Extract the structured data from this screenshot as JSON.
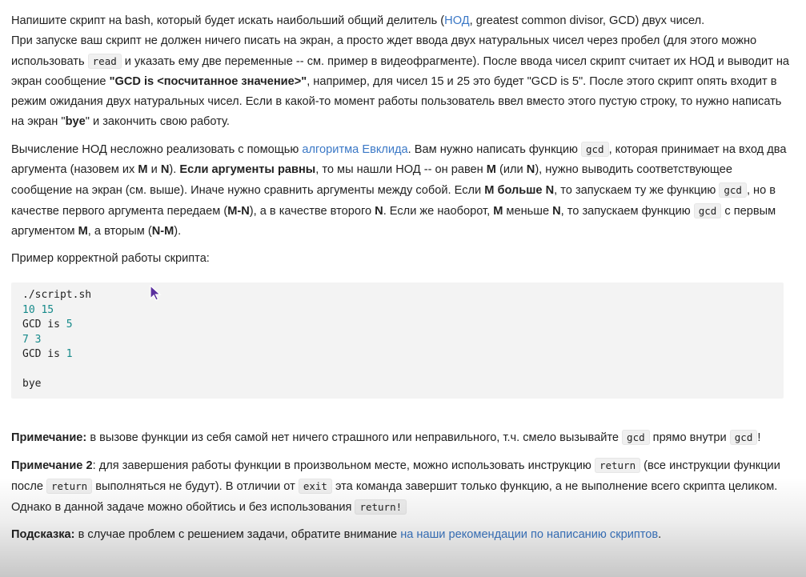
{
  "p1": {
    "t1": "Напишите скрипт на bash, который будет искать наибольший общий делитель (",
    "link_nod": "НОД",
    "t2": ", greatest common divisor, GCD) двух чисел.",
    "t3": "При запуске ваш скрипт не должен ничего писать на экран, а просто ждет ввода двух натуральных чисел через пробел (для этого можно использовать ",
    "code_read": "read",
    "t4": " и указать ему две переменные -- см. пример в видеофрагменте). После ввода чисел скрипт считает их НОД и выводит на экран сообщение ",
    "bold_msg": "\"GCD is <посчитанное значение>\"",
    "t5": ", например, для чисел 15 и 25 это будет \"GCD is 5\". После этого скрипт опять входит в режим ожидания двух натуральных чисел. Если в какой-то момент работы пользователь ввел вместо этого пустую строку, то нужно написать на экран \"",
    "bold_bye": "bye",
    "t6": "\" и закончить свою работу."
  },
  "p2": {
    "t1": "Вычисление НОД несложно реализовать с помощью ",
    "link_euclid": "алгоритма Евклида",
    "t2": ". Вам нужно написать функцию ",
    "code_gcd1": "gcd",
    "t3": ", которая принимает на вход два аргумента (назовем их ",
    "b_m1": "M",
    "t4": " и ",
    "b_n1": "N",
    "t5": "). ",
    "b_equal": "Если аргументы равны",
    "t6": ", то мы нашли НОД -- он равен ",
    "b_m2": "M",
    "t7": " (или ",
    "b_n2": "N",
    "t8": "), нужно выводить соответствующее сообщение на экран (см. выше). Иначе нужно сравнить аргументы между собой. Если ",
    "b_m_gt_n": "M больше N",
    "t9": ", то запускаем ту же функцию ",
    "code_gcd2": "gcd",
    "t10": ", но в качестве первого аргумента передаем (",
    "b_mn": "M-N",
    "t11": "), а в качестве второго ",
    "b_n3": "N",
    "t12": ". Если же наоборот, ",
    "b_m3": "M",
    "t13": " меньше ",
    "b_n4": "N",
    "t14": ", то запускаем функцию ",
    "code_gcd3": "gcd",
    "t15": " с первым аргументом ",
    "b_m4": "M",
    "t16": ", а вторым (",
    "b_nm": "N-M",
    "t17": ")."
  },
  "p3": {
    "text": "Пример корректной работы скрипта:"
  },
  "code": {
    "l1": "./script.sh",
    "l2_a": "10",
    "l2_b": "15",
    "l3_a": "GCD is ",
    "l3_b": "5",
    "l4_a": "7",
    "l4_b": "3",
    "l5_a": "GCD is ",
    "l5_b": "1",
    "l7": "bye"
  },
  "note1": {
    "label": "Примечание:",
    "t1": " в вызове функции из себя самой нет ничего страшного или неправильного, т.ч. смело вызывайте ",
    "code1": "gcd",
    "t2": " прямо внутри ",
    "code2": "gcd",
    "t3": "!"
  },
  "note2": {
    "label": "Примечание 2",
    "t1": ": для завершения работы функции в произвольном месте, можно использовать инструкцию ",
    "code1": "return",
    "t2": " (все инструкции функции после ",
    "code2": "return",
    "t3": " выполняться не будут). В отличии от ",
    "code3": "exit",
    "t4": " эта команда завершит только функцию, а не выполнение всего скрипта целиком. Однако в данной задаче можно обойтись и без использования ",
    "code4": "return!"
  },
  "hint": {
    "label": "Подсказка:",
    "t1": " в случае проблем с решением задачи, обратите внимание ",
    "link": "на наши рекомендации по написанию скриптов",
    "t2": "."
  },
  "colors": {
    "link": "#3b78c6",
    "code_number": "#168a8a",
    "code_bg": "#f3f3f3"
  },
  "icons": {
    "cursor": "mouse-pointer-icon"
  }
}
